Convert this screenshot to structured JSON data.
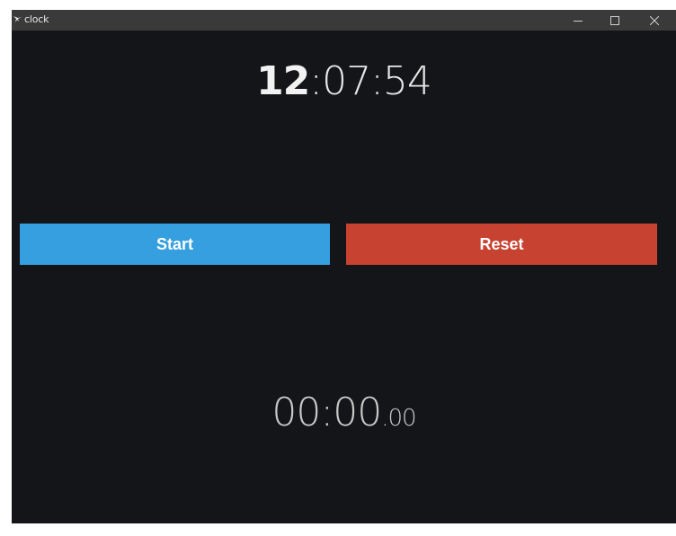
{
  "window": {
    "title": "clock",
    "app_icon": "bird-icon",
    "controls": {
      "minimize_icon": "minimize-icon",
      "maximize_icon": "maximize-icon",
      "close_icon": "close-icon"
    }
  },
  "clock": {
    "hours": "12",
    "rest": ":07:54"
  },
  "buttons": {
    "start_label": "Start",
    "reset_label": "Reset"
  },
  "stopwatch": {
    "main": "00:00",
    "fraction": ".00"
  },
  "colors": {
    "background": "#141518",
    "titlebar": "#3a3a3a",
    "start": "#369fdf",
    "reset": "#c84231",
    "clock_text": "#f2f2f2",
    "stopwatch_text": "#c9c9c9"
  }
}
